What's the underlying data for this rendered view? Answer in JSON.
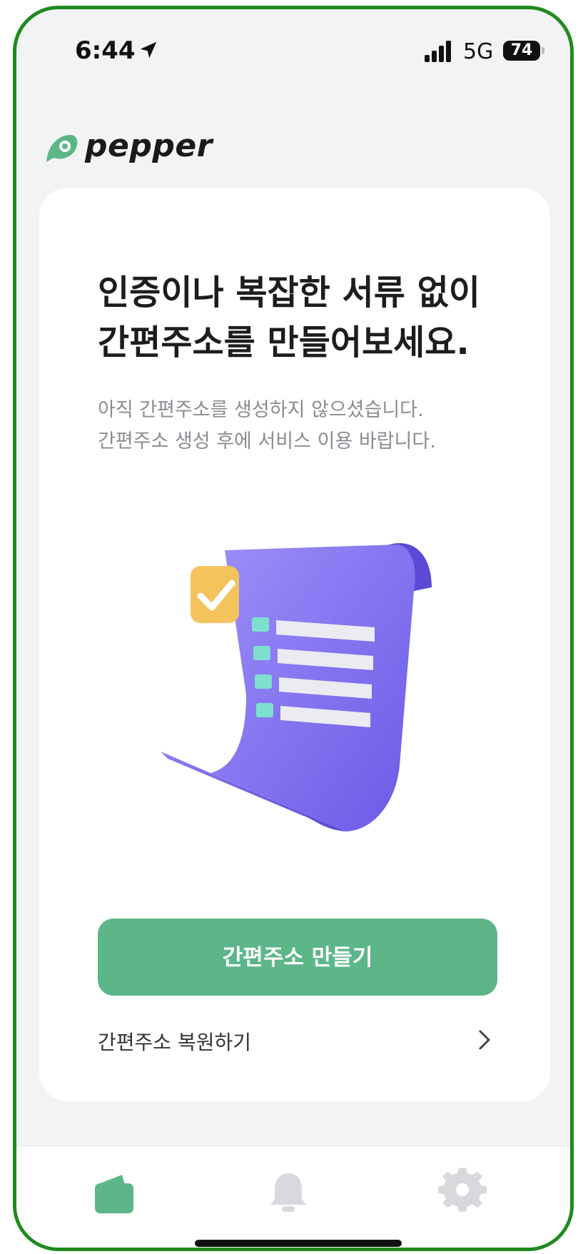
{
  "status_bar": {
    "time": "6:44",
    "network": "5G",
    "battery": "74"
  },
  "header": {
    "brand_name": "pepper"
  },
  "card": {
    "headline_line1": "인증이나 복잡한 서류 없이",
    "headline_line2": "간편주소를 만들어보세요.",
    "subtext_line1": "아직 간편주소를 생성하지 않으셨습니다.",
    "subtext_line2": "간편주소 생성 후에 서비스 이용 바랍니다.",
    "primary_button_label": "간편주소 만들기",
    "restore_label": "간편주소 복원하기"
  },
  "tabs": [
    {
      "icon": "wallet-icon",
      "active": true
    },
    {
      "icon": "bell-icon",
      "active": false
    },
    {
      "icon": "gear-icon",
      "active": false
    }
  ],
  "colors": {
    "accent": "#5cb688",
    "illustration_purple": "#7b6cf0",
    "check_badge": "#f5c35c",
    "list_marker": "#7de0cf",
    "frame_border": "#1f8a1f"
  }
}
